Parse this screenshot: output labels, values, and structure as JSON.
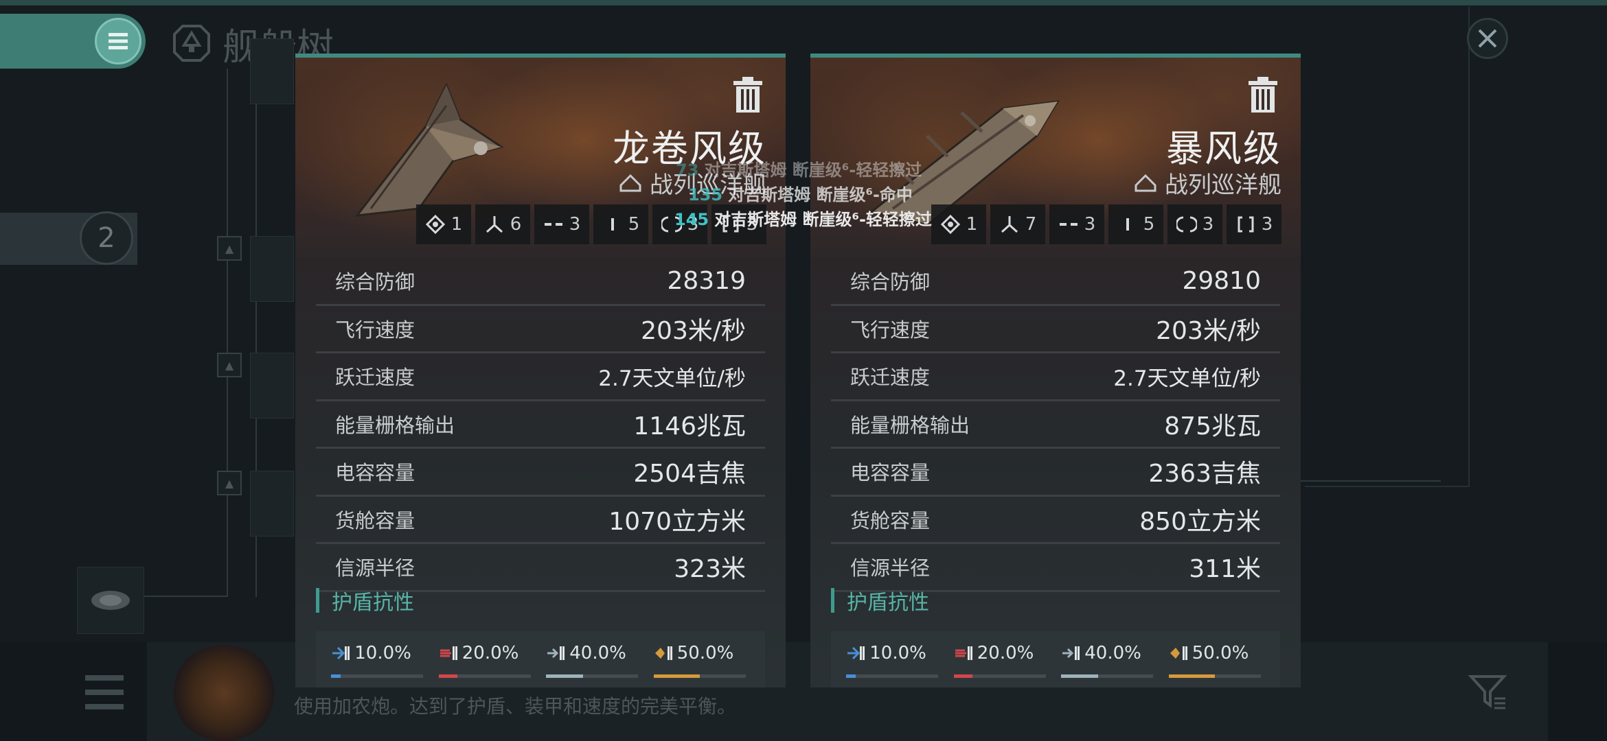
{
  "screen": {
    "title": "舰船树",
    "tier_badge": "2",
    "bottom_description": "使用加农炮。达到了护盾、装甲和速度的完美平衡。"
  },
  "cards": [
    {
      "name": "龙卷风级",
      "class": "战列巡洋舰",
      "slots": [
        {
          "icon": "high-slot-icon",
          "value": "1"
        },
        {
          "icon": "turret-hardpoint-icon",
          "value": "6"
        },
        {
          "icon": "mid-slot-icon",
          "value": "3"
        },
        {
          "icon": "low-slot-icon",
          "value": "5"
        },
        {
          "icon": "rig-slot-icon",
          "value": "3"
        },
        {
          "icon": "subsystem-slot-icon",
          "value": "3"
        }
      ],
      "stats": [
        {
          "label": "综合防御",
          "value": "28319"
        },
        {
          "label": "飞行速度",
          "value": "203米/秒"
        },
        {
          "label": "跃迁速度",
          "value": "2.7天文单位/秒"
        },
        {
          "label": "能量栅格输出",
          "value": "1146兆瓦"
        },
        {
          "label": "电容容量",
          "value": "2504吉焦"
        },
        {
          "label": "货舱容量",
          "value": "1070立方米"
        },
        {
          "label": "信源半径",
          "value": "323米"
        }
      ],
      "shield_title": "护盾抗性",
      "resists": [
        {
          "type": "em",
          "value": "10.0%",
          "fraction": 0.1,
          "color": "#4a8fd6"
        },
        {
          "type": "thermal",
          "value": "20.0%",
          "fraction": 0.2,
          "color": "#d2474b"
        },
        {
          "type": "kinetic",
          "value": "40.0%",
          "fraction": 0.4,
          "color": "#9fb3bc"
        },
        {
          "type": "explosive",
          "value": "50.0%",
          "fraction": 0.5,
          "color": "#d69a3c"
        }
      ]
    },
    {
      "name": "暴风级",
      "class": "战列巡洋舰",
      "slots": [
        {
          "icon": "high-slot-icon",
          "value": "1"
        },
        {
          "icon": "turret-hardpoint-icon",
          "value": "7"
        },
        {
          "icon": "mid-slot-icon",
          "value": "3"
        },
        {
          "icon": "low-slot-icon",
          "value": "5"
        },
        {
          "icon": "rig-slot-icon",
          "value": "3"
        },
        {
          "icon": "subsystem-slot-icon",
          "value": "3"
        }
      ],
      "stats": [
        {
          "label": "综合防御",
          "value": "29810"
        },
        {
          "label": "飞行速度",
          "value": "203米/秒"
        },
        {
          "label": "跃迁速度",
          "value": "2.7天文单位/秒"
        },
        {
          "label": "能量栅格输出",
          "value": "875兆瓦"
        },
        {
          "label": "电容容量",
          "value": "2363吉焦"
        },
        {
          "label": "货舱容量",
          "value": "850立方米"
        },
        {
          "label": "信源半径",
          "value": "311米"
        }
      ],
      "shield_title": "护盾抗性",
      "resists": [
        {
          "type": "em",
          "value": "10.0%",
          "fraction": 0.1,
          "color": "#4a8fd6"
        },
        {
          "type": "thermal",
          "value": "20.0%",
          "fraction": 0.2,
          "color": "#d2474b"
        },
        {
          "type": "kinetic",
          "value": "40.0%",
          "fraction": 0.4,
          "color": "#9fb3bc"
        },
        {
          "type": "explosive",
          "value": "50.0%",
          "fraction": 0.5,
          "color": "#d69a3c"
        }
      ]
    }
  ],
  "combat_log": [
    {
      "number": "73",
      "text": "对吉斯塔姆 断崖级⁶-轻轻擦过"
    },
    {
      "number": "135",
      "text": "对吉斯塔姆 断崖级⁶-命中"
    },
    {
      "number": "145",
      "text": "对吉斯塔姆 断崖级⁶-轻轻擦过"
    }
  ]
}
